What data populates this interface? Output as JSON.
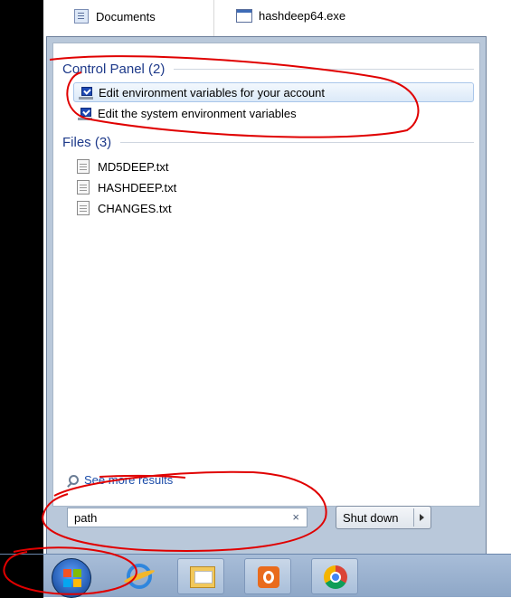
{
  "explorer": {
    "left_item": "Documents",
    "right_item": "hashdeep64.exe"
  },
  "start_menu": {
    "control_panel": {
      "header": "Control Panel (2)",
      "items": [
        {
          "label": "Edit environment variables for your account",
          "selected": true
        },
        {
          "label": "Edit the system environment variables",
          "selected": false
        }
      ]
    },
    "files": {
      "header": "Files (3)",
      "items": [
        {
          "label": "MD5DEEP.txt"
        },
        {
          "label": "HASHDEEP.txt"
        },
        {
          "label": "CHANGES.txt"
        }
      ]
    },
    "see_more": "See more results",
    "search": {
      "value": "path",
      "clear_glyph": "×"
    },
    "shutdown": {
      "label": "Shut down"
    }
  },
  "taskbar": {
    "start_button": "windows-start-orb",
    "pinned": [
      "internet-explorer-icon",
      "file-explorer-icon",
      "media-player-icon",
      "chrome-icon"
    ]
  },
  "colors": {
    "accent_header": "#1e3a8a",
    "link": "#1a4ba8",
    "annotation": "#e00000",
    "taskbar": "#a8bdd8"
  }
}
